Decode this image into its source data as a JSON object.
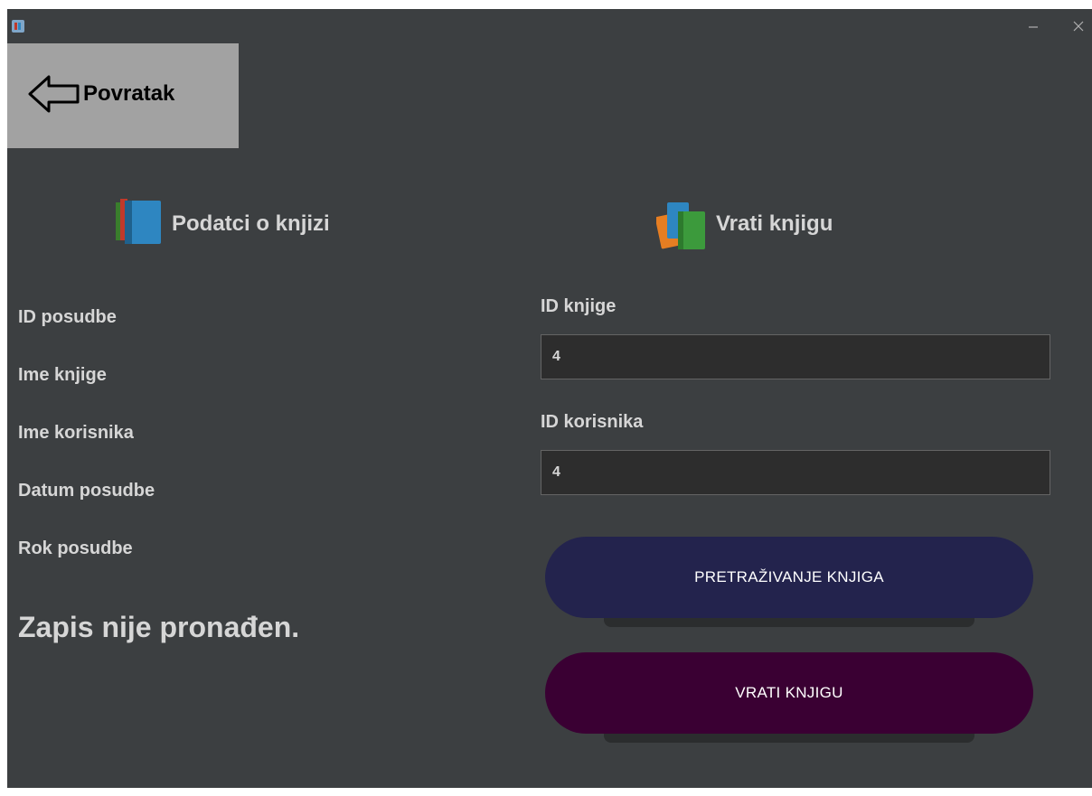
{
  "window": {
    "minimize_glyph": "–",
    "close_glyph": "×"
  },
  "back_button": {
    "label": "Povratak"
  },
  "left_panel": {
    "title": "Podatci o knjizi",
    "labels": [
      "ID posudbe",
      "Ime knjige",
      "Ime korisnika",
      "Datum posudbe",
      "Rok posudbe"
    ],
    "status": "Zapis nije pronađen."
  },
  "right_panel": {
    "title": "Vrati knjigu",
    "book_id_label": "ID knjige",
    "book_id_value": "4",
    "user_id_label": "ID korisnika",
    "user_id_value": "4",
    "search_button": "PRETRAŽIVANJE KNJIGA",
    "return_button": "VRATI KNJIGU"
  },
  "colors": {
    "background": "#3c3f41",
    "back_button": "#a2a2a2",
    "search_button": "#23234d",
    "return_button": "#3a0033",
    "text": "#d6d6d6"
  }
}
